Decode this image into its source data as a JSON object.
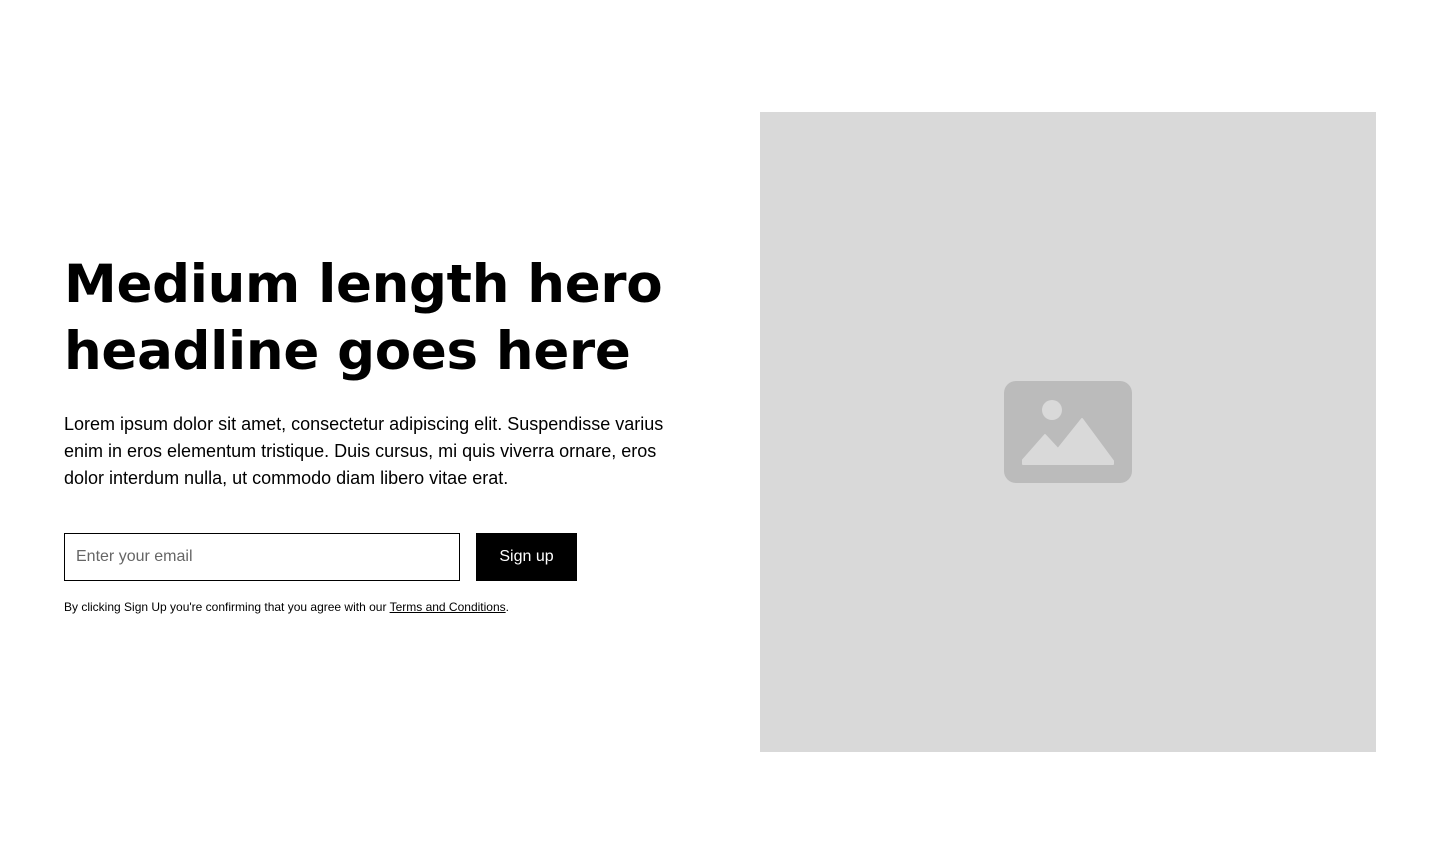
{
  "hero": {
    "headline": "Medium length hero headline goes here",
    "subtext": "Lorem ipsum dolor sit amet, consectetur adipiscing elit. Suspendisse varius enim in eros elementum tristique. Duis cursus, mi quis viverra ornare, eros dolor interdum nulla, ut commodo diam libero vitae erat.",
    "form": {
      "email_placeholder": "Enter your email",
      "email_value": "",
      "button_label": "Sign up"
    },
    "legal": {
      "prefix": "By clicking Sign Up you're confirming that you agree with our ",
      "link_text": "Terms and Conditions",
      "suffix": "."
    }
  },
  "image_panel": {
    "icon": "image-placeholder-icon",
    "background_color": "#d9d9d9",
    "icon_color": "#bbbbbb"
  },
  "colors": {
    "text": "#000000",
    "button_bg": "#000000",
    "button_text": "#ffffff",
    "page_bg": "#ffffff"
  }
}
